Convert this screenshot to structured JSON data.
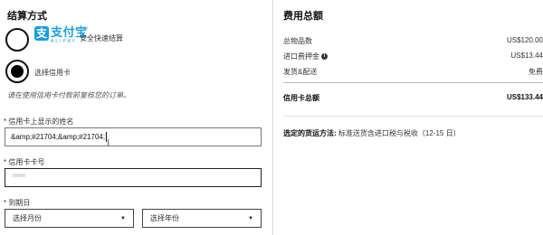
{
  "payment": {
    "title": "结算方式",
    "alipay": {
      "logo_cn": "支付宝",
      "logo_en": "ALIPAY",
      "logo_mark": "支",
      "trademark": "TM",
      "description": "安全快速结算",
      "selected": false
    },
    "card": {
      "label": "选择信用卡",
      "selected": true
    },
    "note": "请在使用信用卡付款前复核您的订单。",
    "fields": {
      "name_label": "* 信用卡上显示的姓名",
      "name_value": "&amp;#21704;&amp;#21704;",
      "number_label": "* 信用卡卡号",
      "expiry_label": "* 到期日",
      "month_placeholder": "选择月份",
      "year_placeholder": "选择年份"
    }
  },
  "summary": {
    "title": "费用总额",
    "rows": [
      {
        "label": "总物品数",
        "value": "US$120.00"
      },
      {
        "label": "进口费押金",
        "value": "US$13.44",
        "info_icon": "info-icon"
      },
      {
        "label": "发货&配送",
        "value": "免费"
      }
    ],
    "total_label": "信用卡总额",
    "total_value": "US$133.44",
    "shipping_label": "选定的货运方法:",
    "shipping_value": "标准送货含进口税与税收（12-15 日）"
  },
  "colors": {
    "alipay_blue": "#1a9de0",
    "text": "#222222",
    "border": "#444444"
  }
}
